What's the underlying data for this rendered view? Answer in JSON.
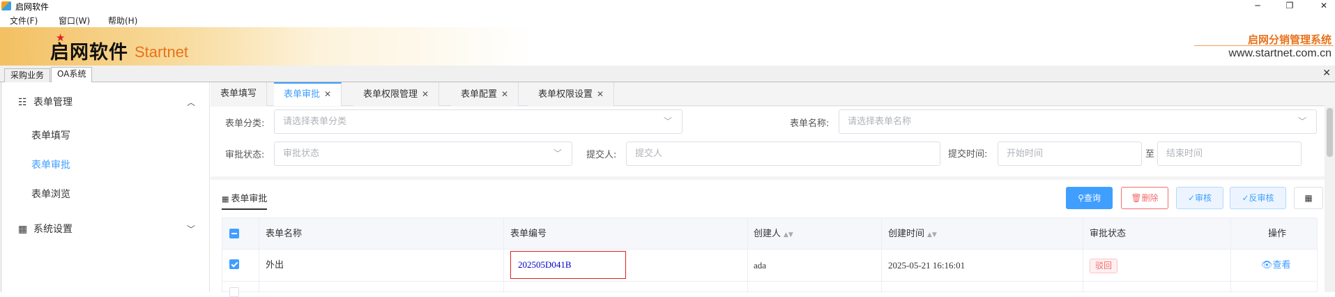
{
  "window": {
    "title": "启网软件"
  },
  "menu": [
    "文件(F)",
    "窗口(W)",
    "帮助(H)"
  ],
  "banner": {
    "logo_cn": "启网软件",
    "logo_en": "Startnet",
    "system_name": "启网分销管理系统",
    "url": "www.startnet.com.cn"
  },
  "outer_tabs": [
    "采购业务",
    "OA系统"
  ],
  "sidebar": {
    "groups": [
      {
        "label": "表单管理",
        "icon": "sliders-icon",
        "expanded": true,
        "items": [
          "表单填写",
          "表单审批",
          "表单浏览"
        ],
        "active": "表单审批"
      },
      {
        "label": "系统设置",
        "icon": "grid-icon",
        "expanded": false
      }
    ]
  },
  "tabs": [
    {
      "label": "表单填写",
      "closable": false
    },
    {
      "label": "表单审批",
      "closable": true,
      "active": true
    },
    {
      "label": "表单权限管理",
      "closable": true
    },
    {
      "label": "表单配置",
      "closable": true
    },
    {
      "label": "表单权限设置",
      "closable": true
    }
  ],
  "filters": {
    "category_label": "表单分类:",
    "category_placeholder": "请选择表单分类",
    "name_label": "表单名称:",
    "name_placeholder": "请选择表单名称",
    "status_label": "审批状态:",
    "status_placeholder": "审批状态",
    "submitter_label": "提交人:",
    "submitter_placeholder": "提交人",
    "time_label": "提交时间:",
    "start_placeholder": "开始时间",
    "to": "至",
    "end_placeholder": "结束时间"
  },
  "panel": {
    "title": "表单审批",
    "buttons": {
      "query": "查询",
      "delete": "删除",
      "audit": "审核",
      "unaudit": "反审核"
    }
  },
  "table": {
    "columns": [
      "表单名称",
      "表单编号",
      "创建人",
      "创建时间",
      "审批状态",
      "操作"
    ],
    "rows": [
      {
        "name": "外出",
        "code": "202505D041B",
        "creator": "ada",
        "created": "2025-05-21 16:16:01",
        "status": "驳回",
        "action": "查看",
        "checked": true
      }
    ]
  },
  "colors": {
    "accent": "#409eff",
    "danger": "#f56c6c",
    "brand_orange": "#e8721c"
  }
}
